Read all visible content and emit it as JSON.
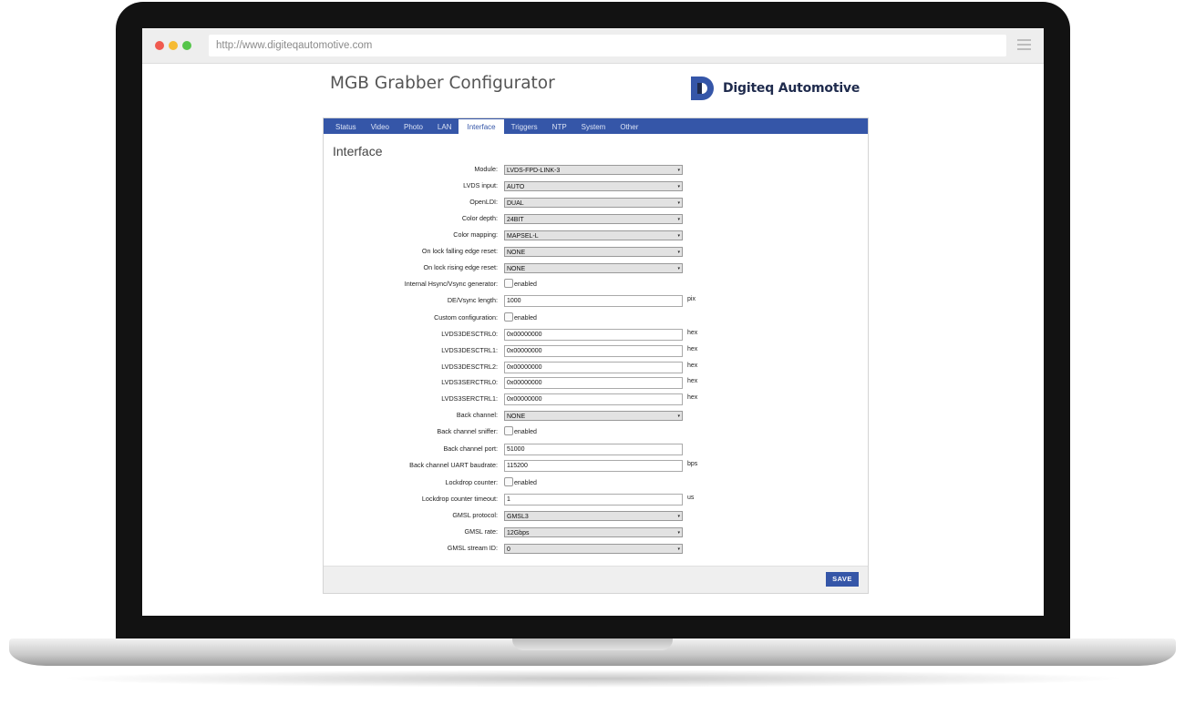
{
  "browser": {
    "url": "http://www.digiteqautomotive.com"
  },
  "app": {
    "title": "MGB Grabber Configurator"
  },
  "brand": {
    "name": "Digiteq Automotive",
    "color": "#1f2b4d",
    "accent": "#3556a8"
  },
  "tabs": [
    {
      "label": "Status"
    },
    {
      "label": "Video"
    },
    {
      "label": "Photo"
    },
    {
      "label": "LAN"
    },
    {
      "label": "Interface"
    },
    {
      "label": "Triggers"
    },
    {
      "label": "NTP"
    },
    {
      "label": "System"
    },
    {
      "label": "Other"
    }
  ],
  "active_tab": "Interface",
  "section": {
    "title": "Interface"
  },
  "fields": [
    {
      "label": "Module:",
      "type": "select",
      "value": "LVDS-FPD-LINK-3"
    },
    {
      "label": "LVDS input:",
      "type": "select",
      "value": "AUTO"
    },
    {
      "label": "OpenLDI:",
      "type": "select",
      "value": "DUAL"
    },
    {
      "label": "Color depth:",
      "type": "select",
      "value": "24BIT"
    },
    {
      "label": "Color mapping:",
      "type": "select",
      "value": "MAPSEL-L"
    },
    {
      "label": "On lock falling edge reset:",
      "type": "select",
      "value": "NONE"
    },
    {
      "label": "On lock rising edge reset:",
      "type": "select",
      "value": "NONE"
    },
    {
      "label": "Internal Hsync/Vsync generator:",
      "type": "checkbox",
      "value": "enabled"
    },
    {
      "label": "DE/Vsync length:",
      "type": "text",
      "value": "1000",
      "unit": "pix"
    },
    {
      "label": "Custom configuration:",
      "type": "checkbox",
      "value": "enabled"
    },
    {
      "label": "LVDS3DESCTRL0:",
      "type": "text",
      "value": "0x00000000",
      "unit": "hex"
    },
    {
      "label": "LVDS3DESCTRL1:",
      "type": "text",
      "value": "0x00000000",
      "unit": "hex"
    },
    {
      "label": "LVDS3DESCTRL2:",
      "type": "text",
      "value": "0x00000000",
      "unit": "hex"
    },
    {
      "label": "LVDS3SERCTRL0:",
      "type": "text",
      "value": "0x00000000",
      "unit": "hex"
    },
    {
      "label": "LVDS3SERCTRL1:",
      "type": "text",
      "value": "0x00000000",
      "unit": "hex"
    },
    {
      "label": "Back channel:",
      "type": "select",
      "value": "NONE"
    },
    {
      "label": "Back channel sniffer:",
      "type": "checkbox",
      "value": "enabled"
    },
    {
      "label": "Back channel port:",
      "type": "text",
      "value": "51000"
    },
    {
      "label": "Back channel UART baudrate:",
      "type": "text",
      "value": "115200",
      "unit": "bps"
    },
    {
      "label": "Lockdrop counter:",
      "type": "checkbox",
      "value": "enabled"
    },
    {
      "label": "Lockdrop counter timeout:",
      "type": "text",
      "value": "1",
      "unit": "us"
    },
    {
      "label": "GMSL protocol:",
      "type": "select",
      "value": "GMSL3"
    },
    {
      "label": "GMSL rate:",
      "type": "select",
      "value": "12Gbps"
    },
    {
      "label": "GMSL stream ID:",
      "type": "select",
      "value": "0"
    }
  ],
  "footer": {
    "save_label": "SAVE"
  }
}
